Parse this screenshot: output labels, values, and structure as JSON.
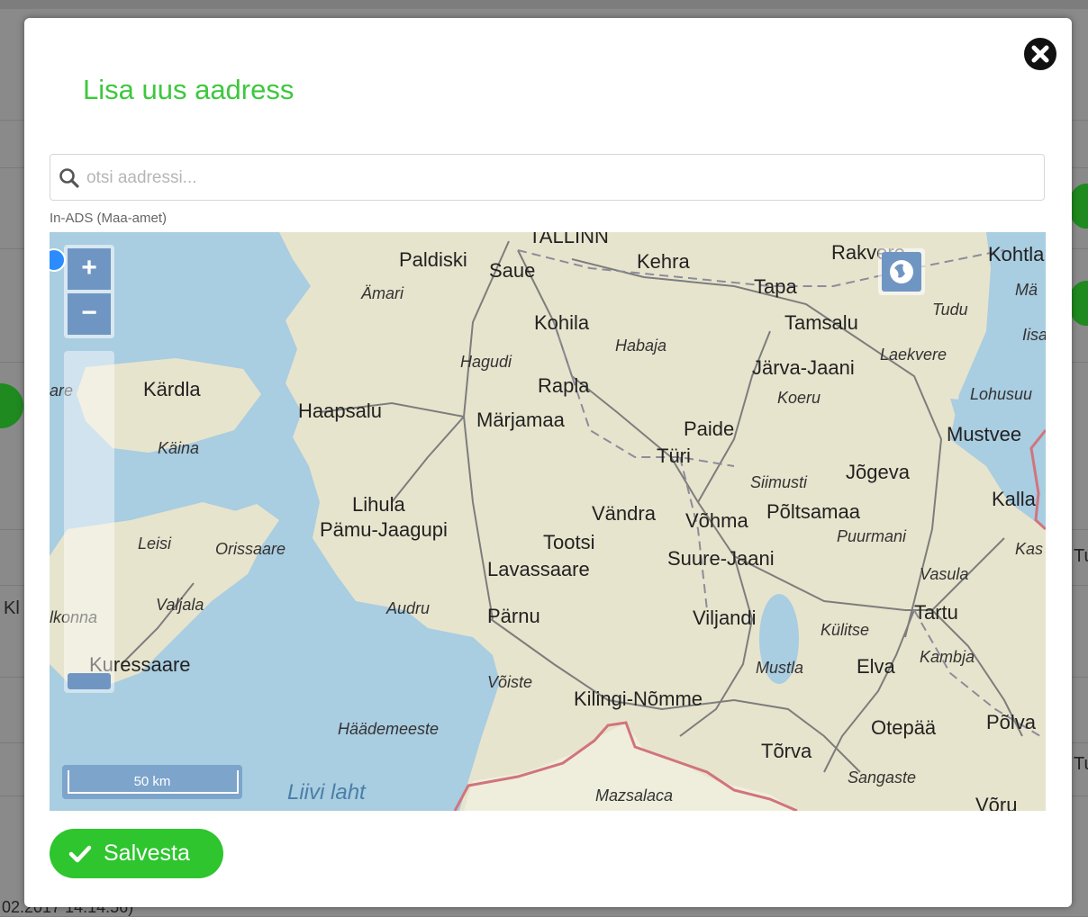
{
  "background": {
    "footer_text": "02.2017 14:14:56)",
    "side_letter_left": "Kl",
    "side_letter_right": "Tu",
    "side_letter_right_2": "Tu"
  },
  "modal": {
    "title": "Lisa uus aadress",
    "close_icon": "close-circle-icon",
    "search": {
      "placeholder": "otsi aadressi...",
      "value": "",
      "icon": "search-icon"
    },
    "source_label": "In-ADS (Maa-amet)",
    "map": {
      "zoom_in_label": "+",
      "zoom_out_label": "−",
      "layer_icon": "globe-icon",
      "scale_label": "50 km",
      "cities": [
        {
          "name": "TALLINN",
          "style": "big"
        },
        {
          "name": "Paldiski",
          "style": "big"
        },
        {
          "name": "Saue",
          "style": "big"
        },
        {
          "name": "Kehra",
          "style": "big"
        },
        {
          "name": "Rakvere",
          "style": "big"
        },
        {
          "name": "Kohtla",
          "style": "big"
        },
        {
          "name": "Ämari",
          "style": "sm"
        },
        {
          "name": "Tapa",
          "style": "big"
        },
        {
          "name": "Tudu",
          "style": "sm"
        },
        {
          "name": "Mä",
          "style": "sm"
        },
        {
          "name": "Kohila",
          "style": "big"
        },
        {
          "name": "Tamsalu",
          "style": "big"
        },
        {
          "name": "Habaja",
          "style": "sm"
        },
        {
          "name": "Iisa",
          "style": "sm"
        },
        {
          "name": "Hagudi",
          "style": "sm"
        },
        {
          "name": "Laekvere",
          "style": "sm"
        },
        {
          "name": "Järva-Jaani",
          "style": "big"
        },
        {
          "name": "Rapla",
          "style": "big"
        },
        {
          "name": "Kärdla",
          "style": "big"
        },
        {
          "name": "Koeru",
          "style": "sm"
        },
        {
          "name": "Lohusuu",
          "style": "sm"
        },
        {
          "name": "Haapsalu",
          "style": "big"
        },
        {
          "name": "Märjamaa",
          "style": "big"
        },
        {
          "name": "Paide",
          "style": "big"
        },
        {
          "name": "Mustvee",
          "style": "big"
        },
        {
          "name": "Käina",
          "style": "sm"
        },
        {
          "name": "Türi",
          "style": "big"
        },
        {
          "name": "Jõgeva",
          "style": "big"
        },
        {
          "name": "Siimusti",
          "style": "sm"
        },
        {
          "name": "Lihula",
          "style": "big"
        },
        {
          "name": "Kalla",
          "style": "big"
        },
        {
          "name": "Pämu-Jaagupi",
          "style": "big"
        },
        {
          "name": "Vändra",
          "style": "big"
        },
        {
          "name": "Võhma",
          "style": "big"
        },
        {
          "name": "Põltsamaa",
          "style": "big"
        },
        {
          "name": "Puurmani",
          "style": "sm"
        },
        {
          "name": "Leisi",
          "style": "sm"
        },
        {
          "name": "Orissaare",
          "style": "sm"
        },
        {
          "name": "Tootsi",
          "style": "big"
        },
        {
          "name": "Kas",
          "style": "sm"
        },
        {
          "name": "Lavassaare",
          "style": "big"
        },
        {
          "name": "Suure-Jaani",
          "style": "big"
        },
        {
          "name": "Vasula",
          "style": "sm"
        },
        {
          "name": "Valjala",
          "style": "sm"
        },
        {
          "name": "Audru",
          "style": "sm"
        },
        {
          "name": "Pärnu",
          "style": "big"
        },
        {
          "name": "Viljandi",
          "style": "big"
        },
        {
          "name": "Tartu",
          "style": "big"
        },
        {
          "name": "Külitse",
          "style": "sm"
        },
        {
          "name": "lkonna",
          "style": "sm"
        },
        {
          "name": "Kambja",
          "style": "sm"
        },
        {
          "name": "Kuressaare",
          "style": "big"
        },
        {
          "name": "Mustla",
          "style": "sm"
        },
        {
          "name": "Elva",
          "style": "big"
        },
        {
          "name": "Võiste",
          "style": "sm"
        },
        {
          "name": "Kilingi-Nõmme",
          "style": "big"
        },
        {
          "name": "Häädemeeste",
          "style": "sm"
        },
        {
          "name": "Otepää",
          "style": "big"
        },
        {
          "name": "Põlva",
          "style": "big"
        },
        {
          "name": "Tõrva",
          "style": "big"
        },
        {
          "name": "Sangaste",
          "style": "sm"
        },
        {
          "name": "Liivi laht",
          "style": "water"
        },
        {
          "name": "Mazsalaca",
          "style": "sm"
        },
        {
          "name": "Võru",
          "style": "big"
        },
        {
          "name": "are",
          "style": "sm"
        }
      ]
    },
    "save_label": "Salvesta",
    "save_icon": "checkmark-icon"
  }
}
